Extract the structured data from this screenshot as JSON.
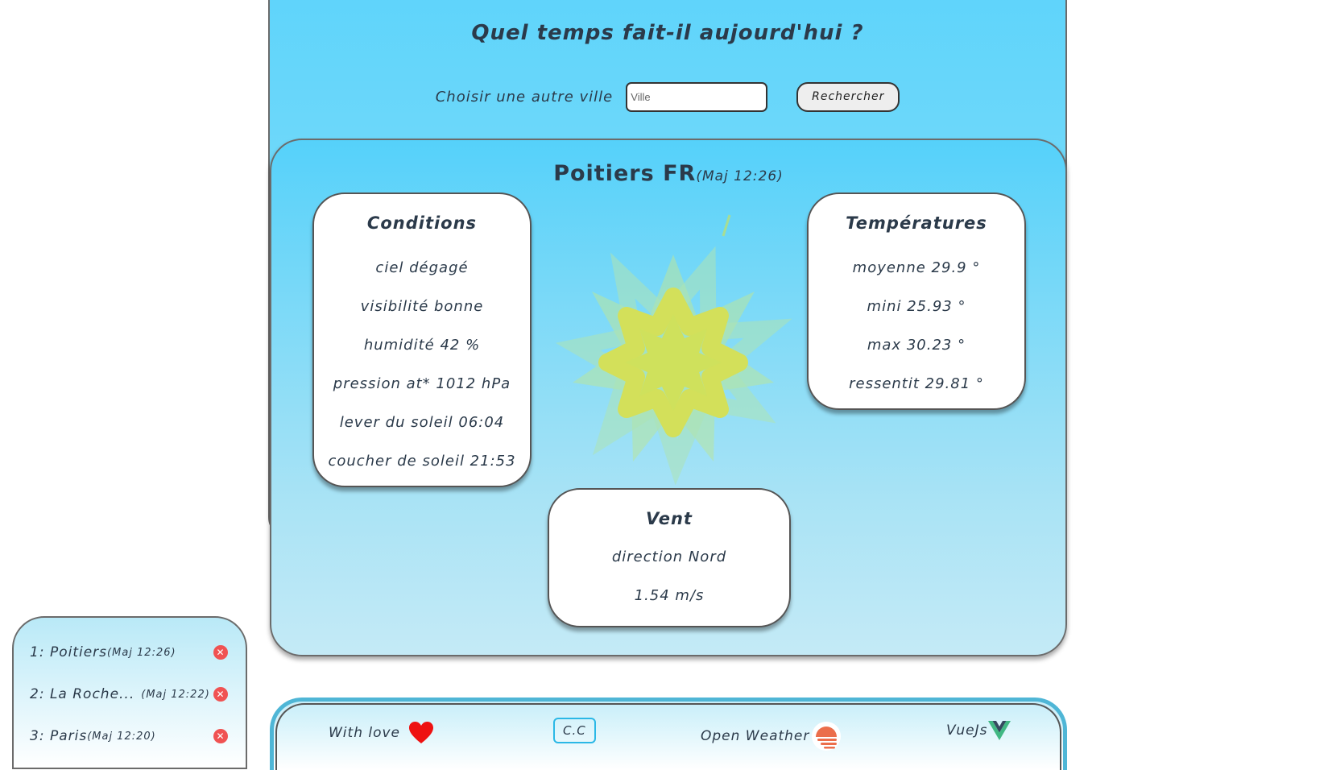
{
  "header": {
    "title": "Quel temps fait-il aujourd'hui ?",
    "search_label": "Choisir une autre ville",
    "search_placeholder": "Ville",
    "search_button": "Rechercher"
  },
  "city": {
    "name": "Poitiers FR",
    "update": "(Maj 12:26)"
  },
  "conditions": {
    "title": "Conditions",
    "lines": [
      "ciel dégagé",
      "visibilité bonne",
      "humidité 42 %",
      "pression at* 1012 hPa",
      "lever du soleil 06:04",
      "coucher de soleil 21:53"
    ]
  },
  "temperatures": {
    "title": "Températures",
    "lines": [
      "moyenne 29.9 °",
      "mini 25.93 °",
      "max 30.23 °",
      "ressentit 29.81 °"
    ]
  },
  "wind": {
    "title": "Vent",
    "lines": [
      "direction Nord",
      "1.54 m/s"
    ]
  },
  "history": [
    {
      "label": "1: Poitiers",
      "update": "(Maj 12:26)"
    },
    {
      "label": "2: La Roche...",
      "update": "(Maj 12:22)"
    },
    {
      "label": "3: Paris",
      "update": "(Maj 12:20)"
    }
  ],
  "footer": {
    "with_love": "With love",
    "cc": "C.C",
    "open_weather": "Open Weather",
    "vuejs": "VueJs"
  },
  "icons": {
    "heart": "heart-icon",
    "open_weather_logo": "open-weather-logo-icon",
    "vue_logo": "vue-logo-icon",
    "remove": "remove-icon",
    "weather_art": "sun-icon"
  },
  "colors": {
    "accent": "#5ed4fb",
    "heart": "#ee1111",
    "remove": "#f05252",
    "vue": "#41b883",
    "open_weather": "#eb6e4b"
  }
}
